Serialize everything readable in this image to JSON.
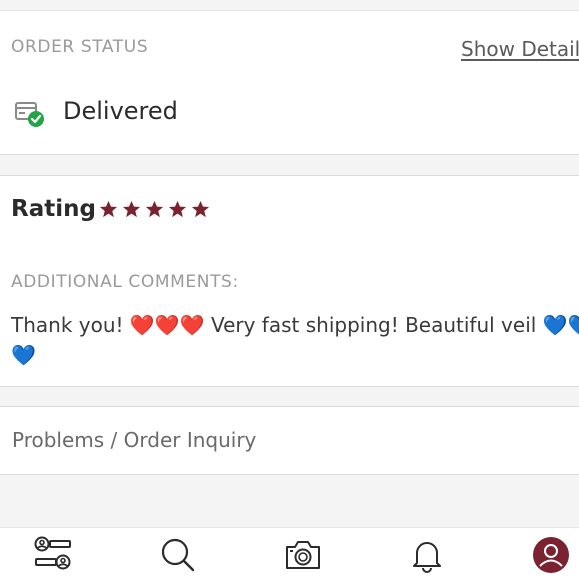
{
  "order_status": {
    "label": "ORDER STATUS",
    "show_details": "Show Details",
    "status_text": "Delivered",
    "status_icon": "delivered-box-check-icon",
    "status_color": "#22a447"
  },
  "rating": {
    "title": "Rating",
    "stars": 5,
    "max_stars": 5,
    "star_color": "#7a2230",
    "comments_label": "ADDITIONAL COMMENTS:",
    "comment": "Thank you! ❤️❤️❤️ Very fast shipping! Beautiful veil 💙💙💙"
  },
  "problems": {
    "label": "Problems / Order Inquiry"
  },
  "tabbar": {
    "items": [
      {
        "name": "feed",
        "icon": "people-list-icon"
      },
      {
        "name": "search",
        "icon": "search-icon"
      },
      {
        "name": "sell",
        "icon": "camera-icon"
      },
      {
        "name": "news",
        "icon": "bell-icon"
      },
      {
        "name": "account",
        "icon": "account-avatar-icon",
        "color": "#7a2230"
      }
    ]
  }
}
